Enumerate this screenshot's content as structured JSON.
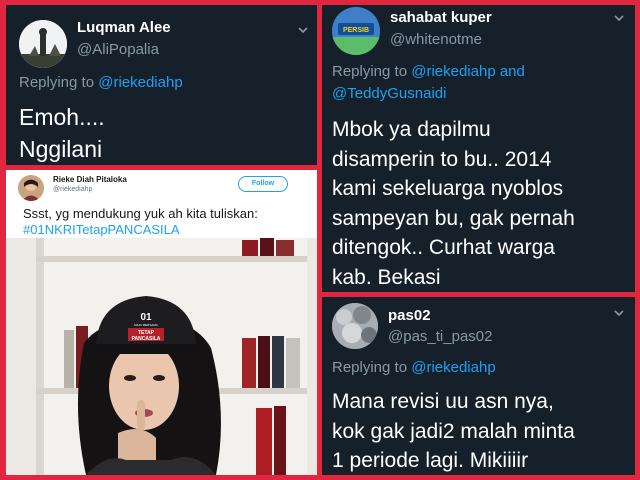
{
  "tweet_luqman": {
    "name": "Luqman Alee",
    "handle": "@AliPopalia",
    "replying_prefix": "Replying to ",
    "replying_to": "@riekediahp",
    "lines": [
      "Emoh....",
      "Nggilani"
    ]
  },
  "tweet_rieke": {
    "name": "Rieke Diah Pitaloka",
    "handle": "@riekediahp",
    "follow_label": "Follow",
    "text": "Ssst, yg mendukung yuk ah kita tuliskan:",
    "hashtag": "#01NKRITetapPANCASILA",
    "cap_number": "01",
    "cap_text_small": "MAJU BERSAMA",
    "cap_text": [
      "TETAP",
      "PANCASILA"
    ]
  },
  "tweet_sahabat": {
    "name": "sahabat kuper",
    "handle": "@whitenotme",
    "avatar_text": "PERSIB",
    "replying_prefix": "Replying to ",
    "replying_to": "@riekediahp",
    "replying_and": " and",
    "replying_to_2": "@TeddyGusnaidi",
    "lines": [
      "Mbok ya dapilmu",
      "disamperin to bu..  2014",
      "kami sekeluarga nyoblos",
      "sampeyan bu, gak pernah",
      "ditengok..  Curhat warga",
      "kab.  Bekasi"
    ]
  },
  "tweet_pas": {
    "name": "pas02",
    "handle": "@pas_ti_pas02",
    "replying_prefix": "Replying to ",
    "replying_to": "@riekediahp",
    "lines": [
      "Mana revisi uu asn nya,",
      "kok gak jadi2 malah minta",
      "1 periode lagi. Mikiiiir"
    ]
  },
  "colors": {
    "border": "#e0273f",
    "dark_bg": "#15202b",
    "muted": "#8899a6",
    "link": "#1da1f2"
  },
  "icons": [
    "chevron-down-icon",
    "avatar-statue",
    "avatar-persib",
    "avatar-stone",
    "avatar-rieke"
  ]
}
